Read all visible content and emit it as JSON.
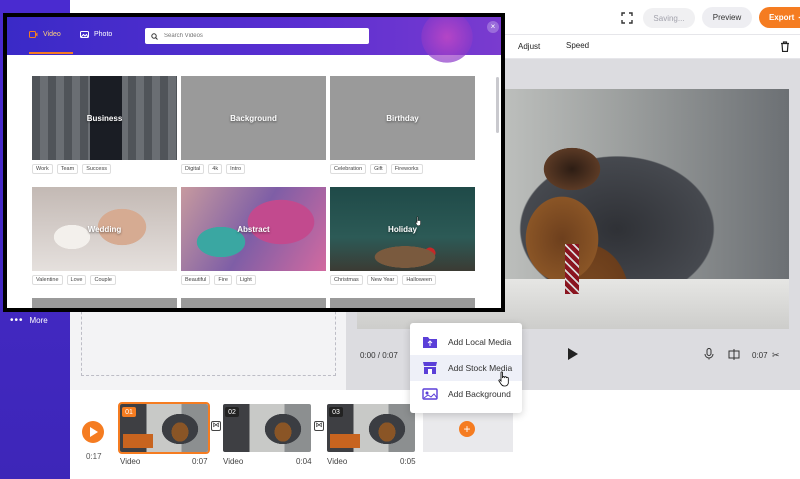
{
  "app": {
    "more_label": "More",
    "saving_label": "Saving...",
    "preview_label": "Preview",
    "export_label": "Export",
    "accent_color": "#f57c21",
    "brand_color": "#4a2bd0"
  },
  "edit_toolbar": {
    "adjust_label": "Adjust",
    "speed_label": "Speed"
  },
  "player": {
    "current_time": "0:00 / 0:07",
    "duration": "0:07"
  },
  "timeline": {
    "total_time": "0:17",
    "clips": [
      {
        "number": "01",
        "label": "Video",
        "duration": "0:07"
      },
      {
        "number": "02",
        "label": "Video",
        "duration": "0:04"
      },
      {
        "number": "03",
        "label": "Video",
        "duration": "0:05"
      }
    ]
  },
  "add_menu": {
    "items": [
      {
        "label": "Add Local Media",
        "icon": "folder-upload-icon"
      },
      {
        "label": "Add Stock Media",
        "icon": "store-icon"
      },
      {
        "label": "Add Background",
        "icon": "background-icon"
      }
    ]
  },
  "stock_dialog": {
    "tabs": {
      "video": "Video",
      "photo": "Photo"
    },
    "search_placeholder": "Search Videos",
    "categories": [
      {
        "title": "Business",
        "tags": [
          "Work",
          "Team",
          "Success"
        ]
      },
      {
        "title": "Background",
        "tags": [
          "Digital",
          "4k",
          "Intro"
        ]
      },
      {
        "title": "Birthday",
        "tags": [
          "Celebration",
          "Gift",
          "Fireworks"
        ]
      },
      {
        "title": "Wedding",
        "tags": [
          "Valentine",
          "Love",
          "Couple"
        ]
      },
      {
        "title": "Abstract",
        "tags": [
          "Beautiful",
          "Fire",
          "Light"
        ]
      },
      {
        "title": "Holiday",
        "tags": [
          "Christmas",
          "New Year",
          "Halloween"
        ]
      }
    ]
  }
}
